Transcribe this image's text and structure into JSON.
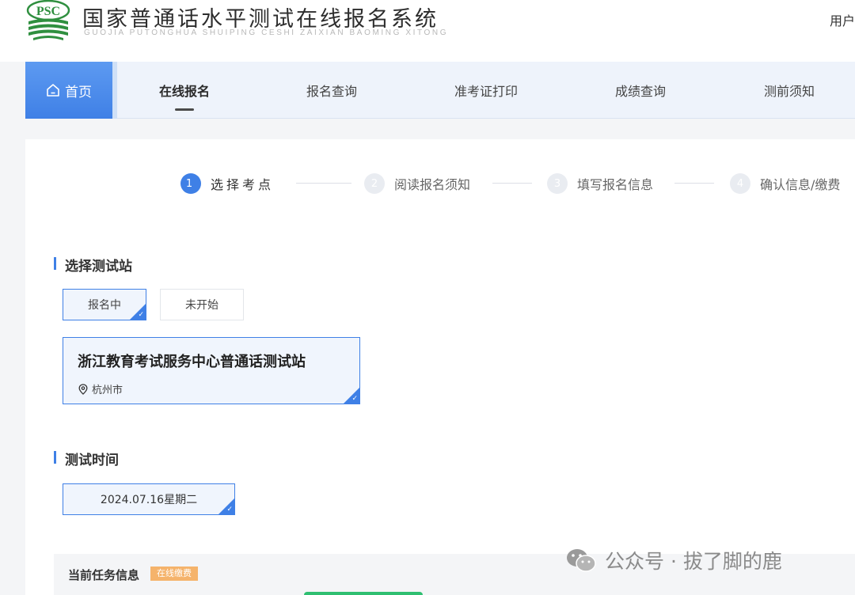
{
  "header": {
    "logo_text": "PSC",
    "title": "国家普通话水平测试在线报名系统",
    "subtitle": "GUOJIA PUTONGHUA SHUIPING CESHI ZAIXIAN BAOMING XITONG",
    "user_label": "用户"
  },
  "nav": {
    "home": "首页",
    "items": [
      "在线报名",
      "报名查询",
      "准考证打印",
      "成绩查询",
      "测前须知"
    ],
    "active_index": 0
  },
  "steps": [
    {
      "num": "1",
      "label": "选择考点",
      "active": true
    },
    {
      "num": "2",
      "label": "阅读报名须知",
      "active": false
    },
    {
      "num": "3",
      "label": "填写报名信息",
      "active": false
    },
    {
      "num": "4",
      "label": "确认信息/缴费",
      "active": false
    }
  ],
  "station_section": {
    "title": "选择测试站",
    "tabs": [
      "报名中",
      "未开始"
    ],
    "selected_tab": 0,
    "station": {
      "name": "浙江教育考试服务中心普通话测试站",
      "city": "杭州市"
    }
  },
  "time_section": {
    "title": "测试时间",
    "date": "2024.07.16星期二"
  },
  "task": {
    "title": "当前任务信息",
    "badge": "在线缴费"
  },
  "watermark": {
    "text": "公众号 · 拔了脚的鹿"
  },
  "colors": {
    "accent": "#3f80e6",
    "badge": "#f5b36b",
    "progress": "#2fbf71"
  }
}
